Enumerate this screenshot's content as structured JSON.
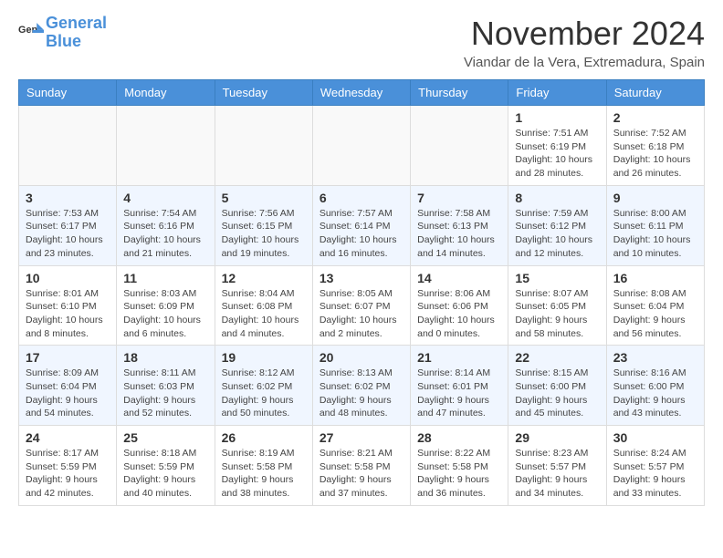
{
  "header": {
    "logo_line1": "General",
    "logo_line2": "Blue",
    "month": "November 2024",
    "location": "Viandar de la Vera, Extremadura, Spain"
  },
  "weekdays": [
    "Sunday",
    "Monday",
    "Tuesday",
    "Wednesday",
    "Thursday",
    "Friday",
    "Saturday"
  ],
  "weeks": [
    [
      {
        "day": "",
        "info": ""
      },
      {
        "day": "",
        "info": ""
      },
      {
        "day": "",
        "info": ""
      },
      {
        "day": "",
        "info": ""
      },
      {
        "day": "",
        "info": ""
      },
      {
        "day": "1",
        "info": "Sunrise: 7:51 AM\nSunset: 6:19 PM\nDaylight: 10 hours\nand 28 minutes."
      },
      {
        "day": "2",
        "info": "Sunrise: 7:52 AM\nSunset: 6:18 PM\nDaylight: 10 hours\nand 26 minutes."
      }
    ],
    [
      {
        "day": "3",
        "info": "Sunrise: 7:53 AM\nSunset: 6:17 PM\nDaylight: 10 hours\nand 23 minutes."
      },
      {
        "day": "4",
        "info": "Sunrise: 7:54 AM\nSunset: 6:16 PM\nDaylight: 10 hours\nand 21 minutes."
      },
      {
        "day": "5",
        "info": "Sunrise: 7:56 AM\nSunset: 6:15 PM\nDaylight: 10 hours\nand 19 minutes."
      },
      {
        "day": "6",
        "info": "Sunrise: 7:57 AM\nSunset: 6:14 PM\nDaylight: 10 hours\nand 16 minutes."
      },
      {
        "day": "7",
        "info": "Sunrise: 7:58 AM\nSunset: 6:13 PM\nDaylight: 10 hours\nand 14 minutes."
      },
      {
        "day": "8",
        "info": "Sunrise: 7:59 AM\nSunset: 6:12 PM\nDaylight: 10 hours\nand 12 minutes."
      },
      {
        "day": "9",
        "info": "Sunrise: 8:00 AM\nSunset: 6:11 PM\nDaylight: 10 hours\nand 10 minutes."
      }
    ],
    [
      {
        "day": "10",
        "info": "Sunrise: 8:01 AM\nSunset: 6:10 PM\nDaylight: 10 hours\nand 8 minutes."
      },
      {
        "day": "11",
        "info": "Sunrise: 8:03 AM\nSunset: 6:09 PM\nDaylight: 10 hours\nand 6 minutes."
      },
      {
        "day": "12",
        "info": "Sunrise: 8:04 AM\nSunset: 6:08 PM\nDaylight: 10 hours\nand 4 minutes."
      },
      {
        "day": "13",
        "info": "Sunrise: 8:05 AM\nSunset: 6:07 PM\nDaylight: 10 hours\nand 2 minutes."
      },
      {
        "day": "14",
        "info": "Sunrise: 8:06 AM\nSunset: 6:06 PM\nDaylight: 10 hours\nand 0 minutes."
      },
      {
        "day": "15",
        "info": "Sunrise: 8:07 AM\nSunset: 6:05 PM\nDaylight: 9 hours\nand 58 minutes."
      },
      {
        "day": "16",
        "info": "Sunrise: 8:08 AM\nSunset: 6:04 PM\nDaylight: 9 hours\nand 56 minutes."
      }
    ],
    [
      {
        "day": "17",
        "info": "Sunrise: 8:09 AM\nSunset: 6:04 PM\nDaylight: 9 hours\nand 54 minutes."
      },
      {
        "day": "18",
        "info": "Sunrise: 8:11 AM\nSunset: 6:03 PM\nDaylight: 9 hours\nand 52 minutes."
      },
      {
        "day": "19",
        "info": "Sunrise: 8:12 AM\nSunset: 6:02 PM\nDaylight: 9 hours\nand 50 minutes."
      },
      {
        "day": "20",
        "info": "Sunrise: 8:13 AM\nSunset: 6:02 PM\nDaylight: 9 hours\nand 48 minutes."
      },
      {
        "day": "21",
        "info": "Sunrise: 8:14 AM\nSunset: 6:01 PM\nDaylight: 9 hours\nand 47 minutes."
      },
      {
        "day": "22",
        "info": "Sunrise: 8:15 AM\nSunset: 6:00 PM\nDaylight: 9 hours\nand 45 minutes."
      },
      {
        "day": "23",
        "info": "Sunrise: 8:16 AM\nSunset: 6:00 PM\nDaylight: 9 hours\nand 43 minutes."
      }
    ],
    [
      {
        "day": "24",
        "info": "Sunrise: 8:17 AM\nSunset: 5:59 PM\nDaylight: 9 hours\nand 42 minutes."
      },
      {
        "day": "25",
        "info": "Sunrise: 8:18 AM\nSunset: 5:59 PM\nDaylight: 9 hours\nand 40 minutes."
      },
      {
        "day": "26",
        "info": "Sunrise: 8:19 AM\nSunset: 5:58 PM\nDaylight: 9 hours\nand 38 minutes."
      },
      {
        "day": "27",
        "info": "Sunrise: 8:21 AM\nSunset: 5:58 PM\nDaylight: 9 hours\nand 37 minutes."
      },
      {
        "day": "28",
        "info": "Sunrise: 8:22 AM\nSunset: 5:58 PM\nDaylight: 9 hours\nand 36 minutes."
      },
      {
        "day": "29",
        "info": "Sunrise: 8:23 AM\nSunset: 5:57 PM\nDaylight: 9 hours\nand 34 minutes."
      },
      {
        "day": "30",
        "info": "Sunrise: 8:24 AM\nSunset: 5:57 PM\nDaylight: 9 hours\nand 33 minutes."
      }
    ]
  ]
}
